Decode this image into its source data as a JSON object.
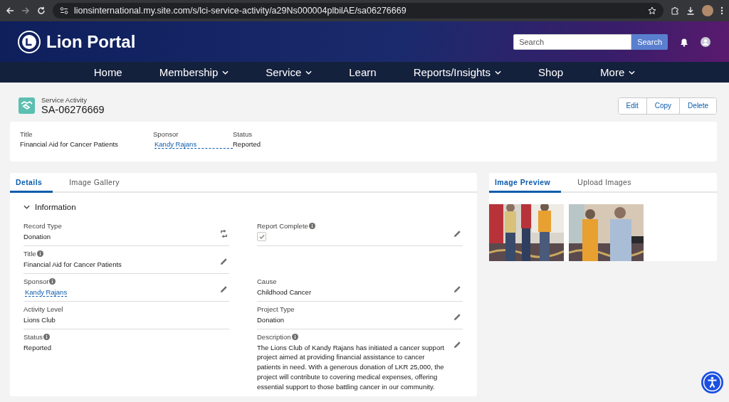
{
  "browser": {
    "url": "lionsinternational.my.site.com/s/lci-service-activity/a29Ns000004plbilAE/sa06276669"
  },
  "header": {
    "title": "Lion Portal",
    "search": {
      "placeholder": "Search",
      "button": "Search"
    }
  },
  "nav": [
    {
      "label": "Home",
      "dropdown": false
    },
    {
      "label": "Membership",
      "dropdown": true
    },
    {
      "label": "Service",
      "dropdown": true
    },
    {
      "label": "Learn",
      "dropdown": false
    },
    {
      "label": "Reports/Insights",
      "dropdown": true
    },
    {
      "label": "Shop",
      "dropdown": false
    },
    {
      "label": "More",
      "dropdown": true
    }
  ],
  "record": {
    "type": "Service Activity",
    "name": "SA-06276669",
    "actions": [
      "Edit",
      "Copy",
      "Delete"
    ]
  },
  "highlights": [
    {
      "label": "Title",
      "value": "Financial Aid for Cancer Patients",
      "kind": "text"
    },
    {
      "label": "Sponsor",
      "value": "Kandy Rajans",
      "kind": "link"
    },
    {
      "label": "Status",
      "value": "Reported",
      "kind": "text"
    }
  ],
  "details": {
    "tabs": [
      {
        "label": "Details",
        "selected": true
      },
      {
        "label": "Image Gallery",
        "selected": false
      }
    ],
    "section": {
      "title": "Information",
      "expanded": true
    },
    "rows": [
      [
        {
          "label": "Record Type",
          "info": false,
          "kind": "text",
          "value": "Donation",
          "editable": false,
          "type_change": true
        },
        {
          "label": "Report Complete",
          "info": true,
          "kind": "checkbox",
          "checked": true,
          "editable": true,
          "type_change": false
        }
      ],
      [
        {
          "label": "Title",
          "info": true,
          "kind": "text",
          "value": "Financial Aid for Cancer Patients",
          "editable": true,
          "type_change": false
        },
        null
      ],
      [
        {
          "label": "Sponsor",
          "info": true,
          "kind": "link",
          "value": "Kandy Rajans",
          "editable": true,
          "type_change": false
        },
        {
          "label": "Cause",
          "info": false,
          "kind": "text",
          "value": "Childhood Cancer",
          "editable": true,
          "type_change": false
        }
      ],
      [
        {
          "label": "Activity Level",
          "info": false,
          "kind": "text",
          "value": "Lions Club",
          "editable": false,
          "type_change": false
        },
        {
          "label": "Project Type",
          "info": false,
          "kind": "text",
          "value": "Donation",
          "editable": true,
          "type_change": false
        }
      ],
      [
        {
          "label": "Status",
          "info": true,
          "kind": "text",
          "value": "Reported",
          "editable": false,
          "type_change": false
        },
        {
          "label": "Description",
          "info": true,
          "kind": "text",
          "value": "The Lions Club of Kandy Rajans has initiated a cancer support project aimed at providing financial assistance to cancer patients in need. With a generous donation of LKR 25,000, the project will contribute to covering medical expenses, offering essential support to those battling cancer in our community.",
          "editable": true,
          "type_change": false
        }
      ]
    ]
  },
  "preview": {
    "tabs": [
      {
        "label": "Image Preview",
        "selected": true
      },
      {
        "label": "Upload Images",
        "selected": false
      }
    ]
  }
}
